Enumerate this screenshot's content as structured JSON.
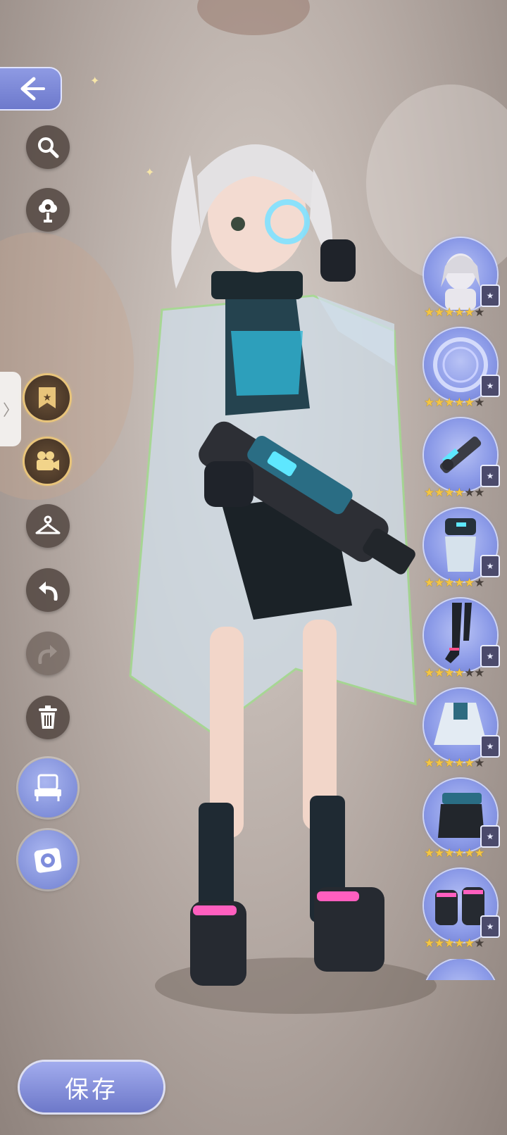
{
  "toolbar": {
    "back": "back-arrow-icon",
    "search": "search-icon",
    "flower": "flower-icon",
    "collection": "star-bookmark-icon",
    "camera_video": "video-camera-icon",
    "hanger": "hanger-icon",
    "undo": "undo-icon",
    "redo": "redo-icon",
    "delete": "trash-icon",
    "dresser": "dresser-icon",
    "photo": "camera-icon"
  },
  "colors": {
    "accent_blue": "#7f8ddc",
    "star_gold": "#f4c542",
    "button_dark": "#463a34"
  },
  "save_label": "保存",
  "outfit_slots": [
    {
      "item": "hair",
      "stars_on": 5,
      "stars_total": 6
    },
    {
      "item": "eye-accessory",
      "stars_on": 5,
      "stars_total": 6
    },
    {
      "item": "weapon",
      "stars_on": 4,
      "stars_total": 6
    },
    {
      "item": "top",
      "stars_on": 5,
      "stars_total": 6
    },
    {
      "item": "socks",
      "stars_on": 4,
      "stars_total": 6
    },
    {
      "item": "coat",
      "stars_on": 5,
      "stars_total": 6
    },
    {
      "item": "skirt",
      "stars_on": 6,
      "stars_total": 6
    },
    {
      "item": "shoes",
      "stars_on": 5,
      "stars_total": 6
    }
  ]
}
